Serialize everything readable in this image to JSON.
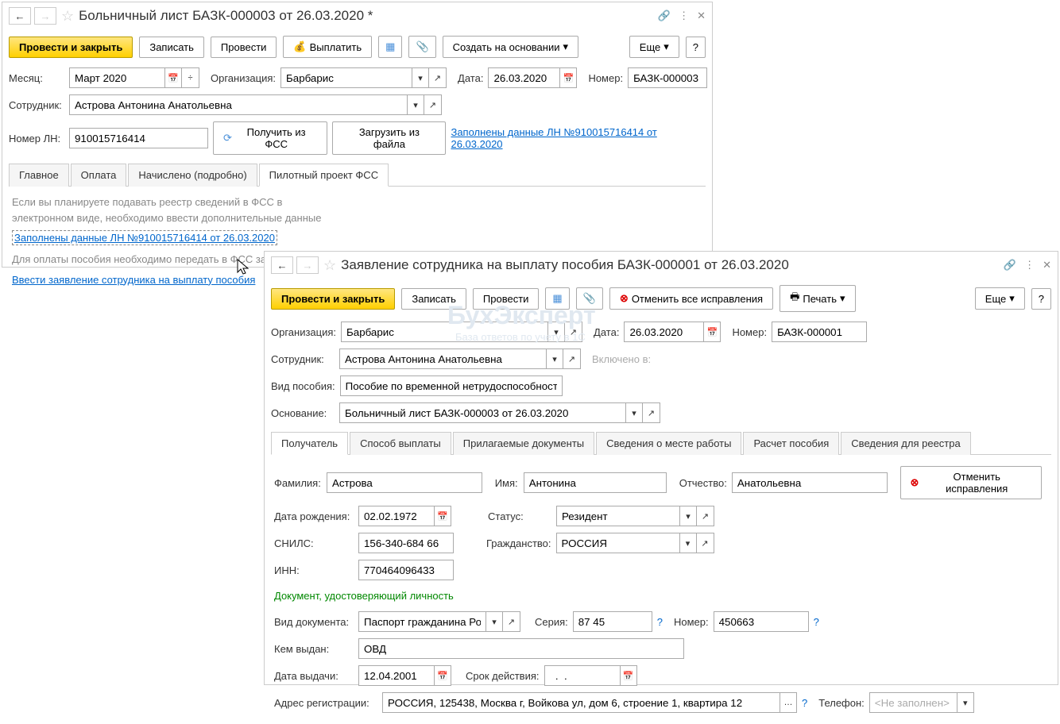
{
  "w1": {
    "title": "Больничный лист БАЗК-000003 от 26.03.2020 *",
    "toolbar": {
      "post_close": "Провести и закрыть",
      "save": "Записать",
      "post": "Провести",
      "pay": "Выплатить",
      "create_based": "Создать на основании",
      "more": "Еще"
    },
    "fields": {
      "month_label": "Месяц:",
      "month_value": "Март 2020",
      "org_label": "Организация:",
      "org_value": "Барбарис",
      "date_label": "Дата:",
      "date_value": "26.03.2020",
      "number_label": "Номер:",
      "number_value": "БАЗК-000003",
      "employee_label": "Сотрудник:",
      "employee_value": "Астрова Антонина Анатольевна",
      "ln_label": "Номер ЛН:",
      "ln_value": "910015716414",
      "get_fss": "Получить из ФСС",
      "load_file": "Загрузить из файла",
      "ln_link": "Заполнены данные ЛН №910015716414 от 26.03.2020"
    },
    "tabs": [
      "Главное",
      "Оплата",
      "Начислено (подробно)",
      "Пилотный проект ФСС"
    ],
    "content": {
      "hint1": "Если вы планируете подавать реестр сведений в ФСС в электронном виде, необходимо ввести дополнительные данные",
      "link1": "Заполнены данные ЛН №910015716414 от 26.03.2020",
      "hint2": "Для оплаты пособия необходимо передать в ФСС заявление работника на выплату пособия",
      "link2": "Ввести заявление сотрудника на выплату пособия"
    }
  },
  "w2": {
    "title": "Заявление сотрудника на выплату пособия БАЗК-000001 от 26.03.2020",
    "toolbar": {
      "post_close": "Провести и закрыть",
      "save": "Записать",
      "post": "Провести",
      "cancel_fix": "Отменить все исправления",
      "print": "Печать",
      "more": "Еще"
    },
    "fields": {
      "org_label": "Организация:",
      "org_value": "Барбарис",
      "date_label": "Дата:",
      "date_value": "26.03.2020",
      "number_label": "Номер:",
      "number_value": "БАЗК-000001",
      "employee_label": "Сотрудник:",
      "employee_value": "Астрова Антонина Анатольевна",
      "included_label": "Включено в:",
      "benefit_type_label": "Вид пособия:",
      "benefit_type_value": "Пособие по временной нетрудоспособности",
      "basis_label": "Основание:",
      "basis_value": "Больничный лист БАЗК-000003 от 26.03.2020"
    },
    "tabs": [
      "Получатель",
      "Способ выплаты",
      "Прилагаемые документы",
      "Сведения о месте работы",
      "Расчет пособия",
      "Сведения для реестра"
    ],
    "recipient": {
      "surname_label": "Фамилия:",
      "surname_value": "Астрова",
      "name_label": "Имя:",
      "name_value": "Антонина",
      "patronymic_label": "Отчество:",
      "patronymic_value": "Анатольевна",
      "cancel_fix": "Отменить исправления",
      "dob_label": "Дата рождения:",
      "dob_value": "02.02.1972",
      "status_label": "Статус:",
      "status_value": "Резидент",
      "snils_label": "СНИЛС:",
      "snils_value": "156-340-684 66",
      "citizenship_label": "Гражданство:",
      "citizenship_value": "РОССИЯ",
      "inn_label": "ИНН:",
      "inn_value": "770464096433",
      "id_doc_header": "Документ, удостоверяющий личность",
      "doc_type_label": "Вид документа:",
      "doc_type_value": "Паспорт гражданина Росс",
      "series_label": "Серия:",
      "series_value": "87 45",
      "docnum_label": "Номер:",
      "docnum_value": "450663",
      "issued_by_label": "Кем выдан:",
      "issued_by_value": "ОВД",
      "issue_date_label": "Дата выдачи:",
      "issue_date_value": "12.04.2001",
      "validity_label": "Срок действия:",
      "validity_value": "  .  .    ",
      "address_label": "Адрес регистрации:",
      "address_value": "РОССИЯ, 125438, Москва г, Войкова ул, дом 6, строение 1, квартира 12",
      "phone_label": "Телефон:",
      "phone_value": "<Не заполнен>"
    },
    "watermark": "БухЭксперт",
    "watermark2": "База ответов по учету в 1С"
  }
}
